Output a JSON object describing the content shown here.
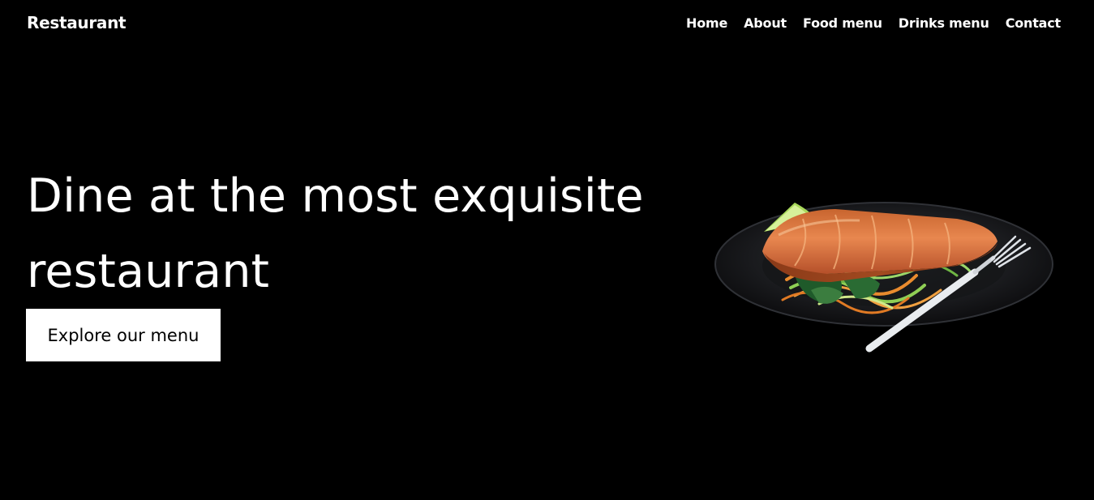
{
  "header": {
    "brand": "Restaurant",
    "nav": [
      {
        "label": "Home"
      },
      {
        "label": "About"
      },
      {
        "label": "Food menu"
      },
      {
        "label": "Drinks menu"
      },
      {
        "label": "Contact"
      }
    ]
  },
  "hero": {
    "title_line1": "Dine at the most exquisite",
    "title_line2": "restaurant",
    "cta_label": "Explore our menu",
    "image_icon": "salmon-dish-image"
  },
  "colors": {
    "background": "#000000",
    "text": "#ffffff",
    "button_bg": "#ffffff",
    "button_text": "#000000"
  }
}
